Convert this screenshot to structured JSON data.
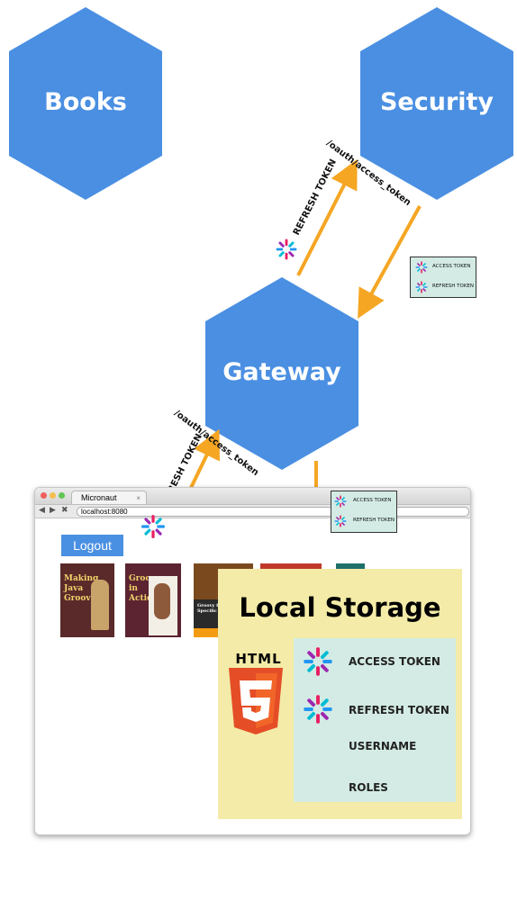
{
  "nodes": {
    "books": "Books",
    "security": "Security",
    "gateway": "Gateway"
  },
  "edges": {
    "gateway_to_security_path": "/oauth/access_token",
    "gateway_to_security_token": "REFRESH TOKEN",
    "browser_to_gateway_path": "/oauth/access_token",
    "browser_to_gateway_token": "REFRESH TOKEN"
  },
  "token_box_security": [
    "ACCESS TOKEN",
    "REFRESH TOKEN"
  ],
  "token_box_gateway": [
    "ACCESS TOKEN",
    "REFRESH TOKEN"
  ],
  "browser": {
    "tab_title": "Micronaut",
    "url": "localhost:8080",
    "logout_label": "Logout",
    "books": [
      {
        "title": "Making Java Groovy",
        "color": "#5a2a2a"
      },
      {
        "title": "Groovy in Action",
        "color": "#5b2430"
      },
      {
        "title": "Groovy for Domain-Specific Languages",
        "color": "#2a2a2a"
      },
      {
        "title": "",
        "color": "#c0392b"
      },
      {
        "title": "",
        "color": "#1f6f6a"
      }
    ]
  },
  "local_storage": {
    "title": "Local Storage",
    "html5_label": "HTML",
    "items": [
      "ACCESS TOKEN",
      "REFRESH TOKEN",
      "USERNAME",
      "ROLES"
    ]
  },
  "colors": {
    "node_fill": "#4a8fe2",
    "arrow": "#f5a623",
    "token_box": "#d3ebe4",
    "storage_bg": "#f3eba7",
    "html5_orange": "#e44d26"
  }
}
